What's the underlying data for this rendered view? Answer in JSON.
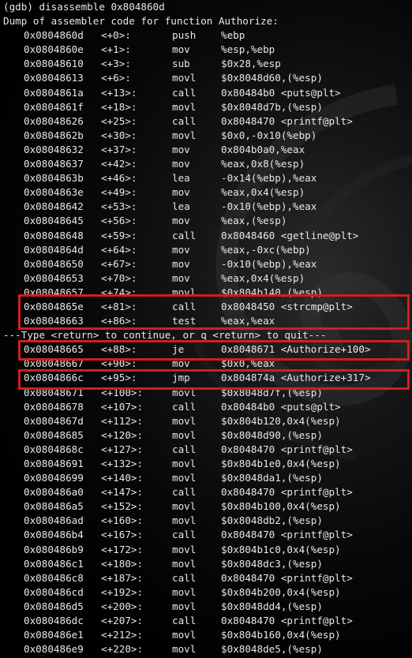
{
  "terminal": {
    "command": "(gdb) disassemble 0x804860d",
    "dump_header": "Dump of assembler code for function Authorize:",
    "pager_prompt": "---Type <return> to continue, or q <return> to quit---",
    "accent_color": "#d21e1e",
    "rows_part1": [
      {
        "addr": "0x0804860d",
        "off": "<+0>:",
        "mnemonic": "push",
        "operands": "%ebp"
      },
      {
        "addr": "0x0804860e",
        "off": "<+1>:",
        "mnemonic": "mov",
        "operands": "%esp,%ebp"
      },
      {
        "addr": "0x08048610",
        "off": "<+3>:",
        "mnemonic": "sub",
        "operands": "$0x28,%esp"
      },
      {
        "addr": "0x08048613",
        "off": "<+6>:",
        "mnemonic": "movl",
        "operands": "$0x8048d60,(%esp)"
      },
      {
        "addr": "0x0804861a",
        "off": "<+13>:",
        "mnemonic": "call",
        "operands": "0x80484b0 <puts@plt>"
      },
      {
        "addr": "0x0804861f",
        "off": "<+18>:",
        "mnemonic": "movl",
        "operands": "$0x8048d7b,(%esp)"
      },
      {
        "addr": "0x08048626",
        "off": "<+25>:",
        "mnemonic": "call",
        "operands": "0x8048470 <printf@plt>"
      },
      {
        "addr": "0x0804862b",
        "off": "<+30>:",
        "mnemonic": "movl",
        "operands": "$0x0,-0x10(%ebp)"
      },
      {
        "addr": "0x08048632",
        "off": "<+37>:",
        "mnemonic": "mov",
        "operands": "0x804b0a0,%eax"
      },
      {
        "addr": "0x08048637",
        "off": "<+42>:",
        "mnemonic": "mov",
        "operands": "%eax,0x8(%esp)"
      },
      {
        "addr": "0x0804863b",
        "off": "<+46>:",
        "mnemonic": "lea",
        "operands": "-0x14(%ebp),%eax"
      },
      {
        "addr": "0x0804863e",
        "off": "<+49>:",
        "mnemonic": "mov",
        "operands": "%eax,0x4(%esp)"
      },
      {
        "addr": "0x08048642",
        "off": "<+53>:",
        "mnemonic": "lea",
        "operands": "-0x10(%ebp),%eax"
      },
      {
        "addr": "0x08048645",
        "off": "<+56>:",
        "mnemonic": "mov",
        "operands": "%eax,(%esp)"
      },
      {
        "addr": "0x08048648",
        "off": "<+59>:",
        "mnemonic": "call",
        "operands": "0x8048460 <getline@plt>"
      },
      {
        "addr": "0x0804864d",
        "off": "<+64>:",
        "mnemonic": "mov",
        "operands": "%eax,-0xc(%ebp)"
      },
      {
        "addr": "0x08048650",
        "off": "<+67>:",
        "mnemonic": "mov",
        "operands": "-0x10(%ebp),%eax"
      },
      {
        "addr": "0x08048653",
        "off": "<+70>:",
        "mnemonic": "mov",
        "operands": "%eax,0x4(%esp)"
      },
      {
        "addr": "0x08048657",
        "off": "<+74>:",
        "mnemonic": "movl",
        "operands": "$0x804b140,(%esp)"
      },
      {
        "addr": "0x0804865e",
        "off": "<+81>:",
        "mnemonic": "call",
        "operands": "0x8048450 <strcmp@plt>"
      },
      {
        "addr": "0x08048663",
        "off": "<+86>:",
        "mnemonic": "test",
        "operands": "%eax,%eax"
      }
    ],
    "rows_part2": [
      {
        "addr": "0x08048665",
        "off": "<+88>:",
        "mnemonic": "je",
        "operands": "0x8048671 <Authorize+100>"
      },
      {
        "addr": "0x08048667",
        "off": "<+90>:",
        "mnemonic": "mov",
        "operands": "$0x0,%eax"
      },
      {
        "addr": "0x0804866c",
        "off": "<+95>:",
        "mnemonic": "jmp",
        "operands": "0x804874a <Authorize+317>"
      },
      {
        "addr": "0x08048671",
        "off": "<+100>:",
        "mnemonic": "movl",
        "operands": "$0x8048d7f,(%esp)"
      },
      {
        "addr": "0x08048678",
        "off": "<+107>:",
        "mnemonic": "call",
        "operands": "0x80484b0 <puts@plt>"
      },
      {
        "addr": "0x0804867d",
        "off": "<+112>:",
        "mnemonic": "movl",
        "operands": "$0x804b120,0x4(%esp)"
      },
      {
        "addr": "0x08048685",
        "off": "<+120>:",
        "mnemonic": "movl",
        "operands": "$0x8048d90,(%esp)"
      },
      {
        "addr": "0x0804868c",
        "off": "<+127>:",
        "mnemonic": "call",
        "operands": "0x8048470 <printf@plt>"
      },
      {
        "addr": "0x08048691",
        "off": "<+132>:",
        "mnemonic": "movl",
        "operands": "$0x804b1e0,0x4(%esp)"
      },
      {
        "addr": "0x08048699",
        "off": "<+140>:",
        "mnemonic": "movl",
        "operands": "$0x8048da1,(%esp)"
      },
      {
        "addr": "0x080486a0",
        "off": "<+147>:",
        "mnemonic": "call",
        "operands": "0x8048470 <printf@plt>"
      },
      {
        "addr": "0x080486a5",
        "off": "<+152>:",
        "mnemonic": "movl",
        "operands": "$0x804b100,0x4(%esp)"
      },
      {
        "addr": "0x080486ad",
        "off": "<+160>:",
        "mnemonic": "movl",
        "operands": "$0x8048db2,(%esp)"
      },
      {
        "addr": "0x080486b4",
        "off": "<+167>:",
        "mnemonic": "call",
        "operands": "0x8048470 <printf@plt>"
      },
      {
        "addr": "0x080486b9",
        "off": "<+172>:",
        "mnemonic": "movl",
        "operands": "$0x804b1c0,0x4(%esp)"
      },
      {
        "addr": "0x080486c1",
        "off": "<+180>:",
        "mnemonic": "movl",
        "operands": "$0x8048dc3,(%esp)"
      },
      {
        "addr": "0x080486c8",
        "off": "<+187>:",
        "mnemonic": "call",
        "operands": "0x8048470 <printf@plt>"
      },
      {
        "addr": "0x080486cd",
        "off": "<+192>:",
        "mnemonic": "movl",
        "operands": "$0x804b200,0x4(%esp)"
      },
      {
        "addr": "0x080486d5",
        "off": "<+200>:",
        "mnemonic": "movl",
        "operands": "$0x8048dd4,(%esp)"
      },
      {
        "addr": "0x080486dc",
        "off": "<+207>:",
        "mnemonic": "call",
        "operands": "0x8048470 <printf@plt>"
      },
      {
        "addr": "0x080486e1",
        "off": "<+212>:",
        "mnemonic": "movl",
        "operands": "$0x804b160,0x4(%esp)"
      },
      {
        "addr": "0x080486e9",
        "off": "<+220>:",
        "mnemonic": "movl",
        "operands": "$0x8048de5,(%esp)"
      }
    ]
  }
}
